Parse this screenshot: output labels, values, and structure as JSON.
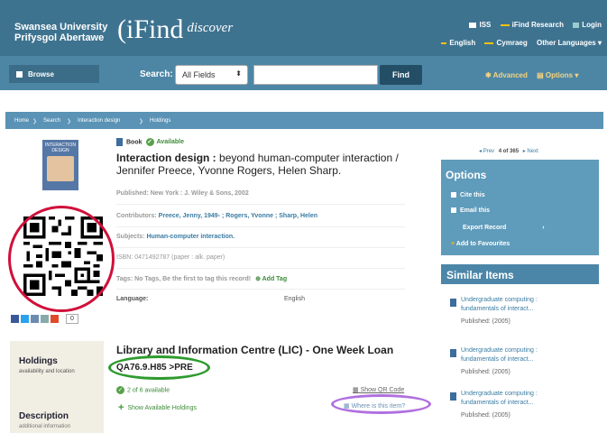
{
  "header": {
    "university_line1": "Swansea University",
    "university_line2": "Prifysgol Abertawe",
    "brand_main": "(iFind",
    "brand_sup": "discover",
    "links": [
      "ISS",
      "iFind Research",
      "Login"
    ],
    "languages": [
      "English",
      "Cymraeg",
      "Other Languages ▾"
    ]
  },
  "searchbar": {
    "browse_label": "Browse",
    "search_label": "Search:",
    "field_selected": "All Fields",
    "query": "",
    "find_label": "Find",
    "advanced_label": "Advanced",
    "options_label": "Options ▾"
  },
  "breadcrumbs": [
    "Home",
    "Search",
    "Interaction design",
    "Holdings"
  ],
  "record": {
    "format": "Book",
    "availability": "Available",
    "title_bold": "Interaction design :",
    "title_rest": " beyond human-computer interaction / Jennifer Preece, Yvonne Rogers, Helen Sharp.",
    "published_label": "Published:",
    "published_value": "New York : J. Wiley & Sons, 2002",
    "contributors_label": "Contributors:",
    "contributors": "Preece, Jenny, 1949- ; Rogers, Yvonne ; Sharp, Helen",
    "subjects_label": "Subjects:",
    "subjects": "Human-computer interaction.",
    "isbn_label": "ISBN:",
    "isbn_value": "0471492787 (paper : alk. paper)",
    "tags_label": "Tags:",
    "tags_text": "No Tags, Be the first to tag this record!",
    "add_tag": "Add Tag",
    "language_label": "Language:",
    "language_value": "English",
    "cover_text": "INTERACTION DESIGN"
  },
  "share": {
    "count": "0"
  },
  "left_panel": {
    "holdings": "Holdings",
    "holdings_sub": "availability and location",
    "description": "Description",
    "description_sub": "additional information"
  },
  "holdings": {
    "location": "Library and Information Centre (LIC) - One Week Loan",
    "call_number": "QA76.9.H85 >PRE",
    "copies": "2 of 6 available",
    "show_qr": "Show QR Code",
    "show_holdings": "Show Available Holdings",
    "where": "Where is this item?"
  },
  "pager": {
    "prev": "Prev",
    "position": "4 of 365",
    "next": "Next"
  },
  "options": {
    "title": "Options",
    "items": [
      "Cite this",
      "Email this",
      "Export Record",
      "Add to Favourites"
    ]
  },
  "similar": {
    "title": "Similar Items",
    "items": [
      {
        "line1": "Undergraduate computing :",
        "line2": "fundamentals of interact...",
        "published": "Published: (2005)"
      },
      {
        "line1": "Undergraduate computing :",
        "line2": "fundamentals of interact...",
        "published": "Published: (2005)"
      },
      {
        "line1": "Undergraduate computing :",
        "line2": "fundamentals of interact...",
        "published": "Published: (2005)"
      }
    ]
  },
  "colors": {
    "header": "#3e7390",
    "accent_green": "#3d8c3a",
    "annotation_red": "#d0103a",
    "annotation_green": "#2e9b2e",
    "annotation_purple": "#b070e0"
  }
}
